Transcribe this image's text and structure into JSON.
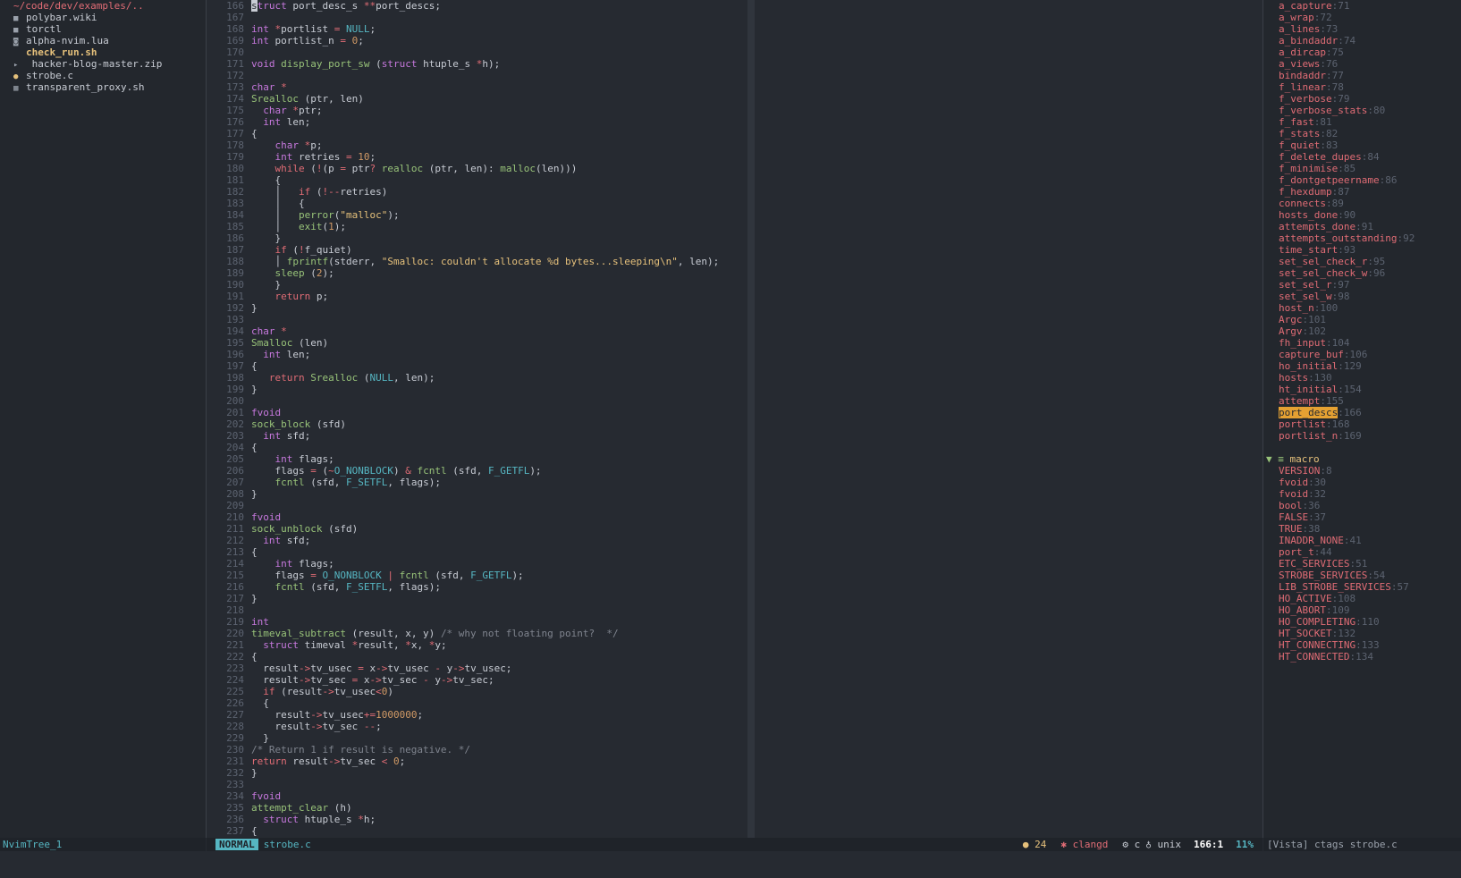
{
  "tree": {
    "root": "~/code/dev/examples/..",
    "entries": [
      {
        "icon": "■",
        "name": "polybar.wiki"
      },
      {
        "icon": "■",
        "name": "torctl"
      },
      {
        "icon": "◙",
        "name": "alpha-nvim.lua"
      },
      {
        "icon": "",
        "name": "check_run.sh"
      },
      {
        "icon": "▸",
        "name": " hacker-blog-master.zip"
      },
      {
        "icon": "●",
        "name": "strobe.c"
      },
      {
        "icon": "▦",
        "name": "transparent_proxy.sh"
      }
    ]
  },
  "editor": {
    "lines": [
      {
        "n": "166",
        "t": "struct port_desc_s **port_descs;"
      },
      {
        "n": "167",
        "t": ""
      },
      {
        "n": "168",
        "t": "int *portlist = NULL;"
      },
      {
        "n": "169",
        "t": "int portlist_n = 0;"
      },
      {
        "n": "170",
        "t": ""
      },
      {
        "n": "171",
        "t": "void display_port_sw (struct htuple_s *h);"
      },
      {
        "n": "172",
        "t": ""
      },
      {
        "n": "173",
        "t": "char *"
      },
      {
        "n": "174",
        "t": "Srealloc (ptr, len)"
      },
      {
        "n": "175",
        "t": "  char *ptr;"
      },
      {
        "n": "176",
        "t": "  int len;"
      },
      {
        "n": "177",
        "t": "{"
      },
      {
        "n": "178",
        "t": "    char *p;"
      },
      {
        "n": "179",
        "t": "    int retries = 10;"
      },
      {
        "n": "180",
        "t": "    while (!(p = ptr? realloc (ptr, len): malloc(len)))"
      },
      {
        "n": "181",
        "t": "    {"
      },
      {
        "n": "182",
        "t": "    │   if (!--retries)"
      },
      {
        "n": "183",
        "t": "    │   {"
      },
      {
        "n": "184",
        "t": "    │   perror(\"malloc\");"
      },
      {
        "n": "185",
        "t": "    │   exit(1);"
      },
      {
        "n": "186",
        "t": "    }"
      },
      {
        "n": "187",
        "t": "    if (!f_quiet)"
      },
      {
        "n": "188",
        "t": "    │ fprintf(stderr, \"Smalloc: couldn't allocate %d bytes...sleeping\\n\", len);"
      },
      {
        "n": "189",
        "t": "    sleep (2);"
      },
      {
        "n": "190",
        "t": "    }"
      },
      {
        "n": "191",
        "t": "    return p;"
      },
      {
        "n": "192",
        "t": "}"
      },
      {
        "n": "193",
        "t": ""
      },
      {
        "n": "194",
        "t": "char *"
      },
      {
        "n": "195",
        "t": "Smalloc (len)"
      },
      {
        "n": "196",
        "t": "  int len;"
      },
      {
        "n": "197",
        "t": "{"
      },
      {
        "n": "198",
        "t": "   return Srealloc (NULL, len);"
      },
      {
        "n": "199",
        "t": "}"
      },
      {
        "n": "200",
        "t": ""
      },
      {
        "n": "201",
        "t": "fvoid"
      },
      {
        "n": "202",
        "t": "sock_block (sfd)"
      },
      {
        "n": "203",
        "t": "  int sfd;"
      },
      {
        "n": "204",
        "t": "{"
      },
      {
        "n": "205",
        "t": "    int flags;"
      },
      {
        "n": "206",
        "t": "    flags = (~O_NONBLOCK) & fcntl (sfd, F_GETFL);"
      },
      {
        "n": "207",
        "t": "    fcntl (sfd, F_SETFL, flags);"
      },
      {
        "n": "208",
        "t": "}"
      },
      {
        "n": "209",
        "t": ""
      },
      {
        "n": "210",
        "t": "fvoid"
      },
      {
        "n": "211",
        "t": "sock_unblock (sfd)"
      },
      {
        "n": "212",
        "t": "  int sfd;"
      },
      {
        "n": "213",
        "t": "{"
      },
      {
        "n": "214",
        "t": "    int flags;"
      },
      {
        "n": "215",
        "t": "    flags = O_NONBLOCK | fcntl (sfd, F_GETFL);"
      },
      {
        "n": "216",
        "t": "    fcntl (sfd, F_SETFL, flags);"
      },
      {
        "n": "217",
        "t": "}"
      },
      {
        "n": "218",
        "t": ""
      },
      {
        "n": "219",
        "t": "int"
      },
      {
        "n": "220",
        "t": "timeval_subtract (result, x, y) /* why not floating point?  */"
      },
      {
        "n": "221",
        "t": "  struct timeval *result, *x, *y;"
      },
      {
        "n": "222",
        "t": "{"
      },
      {
        "n": "223",
        "t": "  result->tv_usec = x->tv_usec - y->tv_usec;"
      },
      {
        "n": "224",
        "t": "  result->tv_sec = x->tv_sec - y->tv_sec;"
      },
      {
        "n": "225",
        "t": "  if (result->tv_usec<0)"
      },
      {
        "n": "226",
        "t": "  {"
      },
      {
        "n": "227",
        "t": "    result->tv_usec+=1000000;"
      },
      {
        "n": "228",
        "t": "    result->tv_sec --;"
      },
      {
        "n": "229",
        "t": "  }"
      },
      {
        "n": "230",
        "t": "/* Return 1 if result is negative. */"
      },
      {
        "n": "231",
        "t": "return result->tv_sec < 0;"
      },
      {
        "n": "232",
        "t": "}"
      },
      {
        "n": "233",
        "t": ""
      },
      {
        "n": "234",
        "t": "fvoid"
      },
      {
        "n": "235",
        "t": "attempt_clear (h)"
      },
      {
        "n": "236",
        "t": "  struct htuple_s *h;"
      },
      {
        "n": "237",
        "t": "{"
      }
    ]
  },
  "vista": {
    "tags": [
      {
        "name": "a_capture",
        "line": ":71"
      },
      {
        "name": "a_wrap",
        "line": ":72"
      },
      {
        "name": "a_lines",
        "line": ":73"
      },
      {
        "name": "a_bindaddr",
        "line": ":74"
      },
      {
        "name": "a_dircap",
        "line": ":75"
      },
      {
        "name": "a_views",
        "line": ":76"
      },
      {
        "name": "bindaddr",
        "line": ":77"
      },
      {
        "name": "f_linear",
        "line": ":78"
      },
      {
        "name": "f_verbose",
        "line": ":79"
      },
      {
        "name": "f_verbose_stats",
        "line": ":80"
      },
      {
        "name": "f_fast",
        "line": ":81"
      },
      {
        "name": "f_stats",
        "line": ":82"
      },
      {
        "name": "f_quiet",
        "line": ":83"
      },
      {
        "name": "f_delete_dupes",
        "line": ":84"
      },
      {
        "name": "f_minimise",
        "line": ":85"
      },
      {
        "name": "f_dontgetpeername",
        "line": ":86"
      },
      {
        "name": "f_hexdump",
        "line": ":87"
      },
      {
        "name": "connects",
        "line": ":89"
      },
      {
        "name": "hosts_done",
        "line": ":90"
      },
      {
        "name": "attempts_done",
        "line": ":91"
      },
      {
        "name": "attempts_outstanding",
        "line": ":92"
      },
      {
        "name": "time_start",
        "line": ":93"
      },
      {
        "name": "set_sel_check_r",
        "line": ":95"
      },
      {
        "name": "set_sel_check_w",
        "line": ":96"
      },
      {
        "name": "set_sel_r",
        "line": ":97"
      },
      {
        "name": "set_sel_w",
        "line": ":98"
      },
      {
        "name": "host_n",
        "line": ":100"
      },
      {
        "name": "Argc",
        "line": ":101"
      },
      {
        "name": "Argv",
        "line": ":102"
      },
      {
        "name": "fh_input",
        "line": ":104"
      },
      {
        "name": "capture_buf",
        "line": ":106"
      },
      {
        "name": "ho_initial",
        "line": ":129"
      },
      {
        "name": "hosts",
        "line": ":130"
      },
      {
        "name": "ht_initial",
        "line": ":154"
      },
      {
        "name": "attempt",
        "line": ":155"
      },
      {
        "name": "port_descs",
        "line": ":166"
      },
      {
        "name": "portlist",
        "line": ":168"
      },
      {
        "name": "portlist_n",
        "line": ":169"
      }
    ],
    "group_label": "macro",
    "macros": [
      {
        "name": "VERSION",
        "line": ":8"
      },
      {
        "name": "fvoid",
        "line": ":30"
      },
      {
        "name": "fvoid",
        "line": ":32"
      },
      {
        "name": "bool",
        "line": ":36"
      },
      {
        "name": "FALSE",
        "line": ":37"
      },
      {
        "name": "TRUE",
        "line": ":38"
      },
      {
        "name": "INADDR_NONE",
        "line": ":41"
      },
      {
        "name": "port_t",
        "line": ":44"
      },
      {
        "name": "ETC_SERVICES",
        "line": ":51"
      },
      {
        "name": "STROBE_SERVICES",
        "line": ":54"
      },
      {
        "name": "LIB_STROBE_SERVICES",
        "line": ":57"
      },
      {
        "name": "HO_ACTIVE",
        "line": ":108"
      },
      {
        "name": "HO_ABORT",
        "line": ":109"
      },
      {
        "name": "HO_COMPLETING",
        "line": ":110"
      },
      {
        "name": "HT_SOCKET",
        "line": ":132"
      },
      {
        "name": "HT_CONNECTING",
        "line": ":133"
      },
      {
        "name": "HT_CONNECTED",
        "line": ":134"
      }
    ]
  },
  "status": {
    "tree_label": "NvimTree_1",
    "mode": "NORMAL",
    "file": "strobe.c",
    "warnings": "24",
    "lsp": "clangd",
    "filetype": "c",
    "encoding": "unix",
    "position": "166:1",
    "percent": "11%",
    "vista_label": "[Vista] ctags strobe.c"
  },
  "colors": {
    "background": "#262a31",
    "accent": "#56b6c2",
    "tag": "#e06c75",
    "highlight": "#e5a132"
  }
}
